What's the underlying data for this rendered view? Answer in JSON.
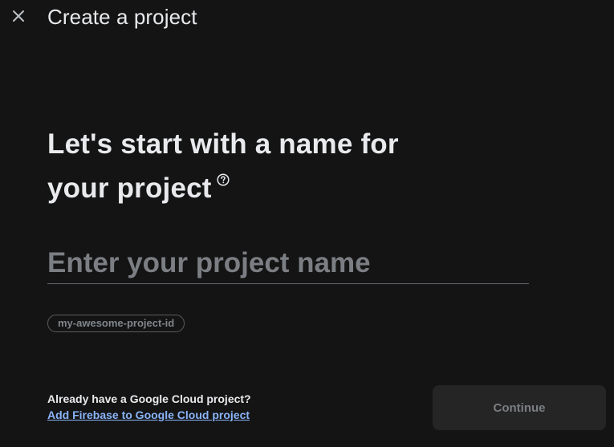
{
  "header": {
    "title": "Create a project",
    "close_icon": "close-icon"
  },
  "main": {
    "heading_line1": "Let's start with a name for",
    "heading_line2": "your project",
    "help_icon": "help-circle-icon",
    "name_input": {
      "placeholder": "Enter your project name",
      "value": ""
    },
    "project_id_chip": "my-awesome-project-id"
  },
  "footer": {
    "already_text": "Already have a Google Cloud project?",
    "add_link": "Add Firebase to Google Cloud project",
    "continue_label": "Continue"
  },
  "colors": {
    "background": "#141414",
    "text": "#e8eaed",
    "link": "#8ab4f8",
    "muted": "#7b7e83",
    "button_disabled_bg": "#252525"
  }
}
